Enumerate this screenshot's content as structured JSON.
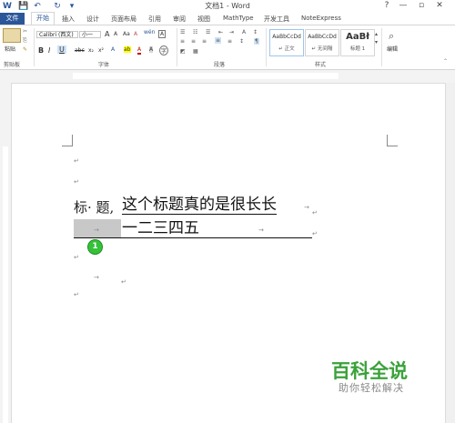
{
  "window": {
    "title": "文档1 - Word",
    "help": "?",
    "minimize": "—",
    "restore": "▫",
    "close": "✕"
  },
  "qat": {
    "word_icon": "W",
    "save_icon": "💾",
    "undo_icon": "↶",
    "redo_icon": "↻",
    "custom_icon": "▾"
  },
  "tabs": [
    {
      "label": "文件"
    },
    {
      "label": "开始"
    },
    {
      "label": "插入"
    },
    {
      "label": "设计"
    },
    {
      "label": "页面布局"
    },
    {
      "label": "引用"
    },
    {
      "label": "审阅"
    },
    {
      "label": "视图"
    },
    {
      "label": "MathType"
    },
    {
      "label": "开发工具"
    },
    {
      "label": "NoteExpress"
    }
  ],
  "ribbon": {
    "clipboard": {
      "paste_label": "粘贴",
      "group_label": "剪贴板"
    },
    "font": {
      "font_name": "Calibri (西文)",
      "font_size": "小一",
      "bold": "B",
      "italic": "I",
      "underline": "U",
      "strike": "abc",
      "subscript": "x₂",
      "superscript": "x²",
      "grow": "A",
      "shrink": "A",
      "case": "Aa",
      "clear": "A",
      "wen": "wén",
      "border_char": "A",
      "highlight": "ab",
      "font_color": "A",
      "shade": "A",
      "circle": "字",
      "group_label": "字体"
    },
    "paragraph": {
      "group_label": "段落"
    },
    "styles": {
      "items": [
        {
          "preview": "AaBbCcDd",
          "name": "↵ 正文"
        },
        {
          "preview": "AaBbCcDd",
          "name": "↵ 无间隔"
        },
        {
          "preview": "AaBł",
          "name": "标题 1"
        }
      ],
      "group_label": "样式"
    },
    "editing": {
      "label": "编辑"
    }
  },
  "document": {
    "line1_label": "标· 题,",
    "line1_title": "这个标题真的是很长长",
    "line2_text": "一二三四五",
    "para_mark": "↵",
    "tab_arrow": "→",
    "badge": "1"
  },
  "watermark": {
    "title": "百科全说",
    "subtitle": "助你轻松解决"
  },
  "colors": {
    "brand": "#2b579a",
    "watermark_green": "#3aa23a",
    "badge_green": "#35c23a"
  }
}
